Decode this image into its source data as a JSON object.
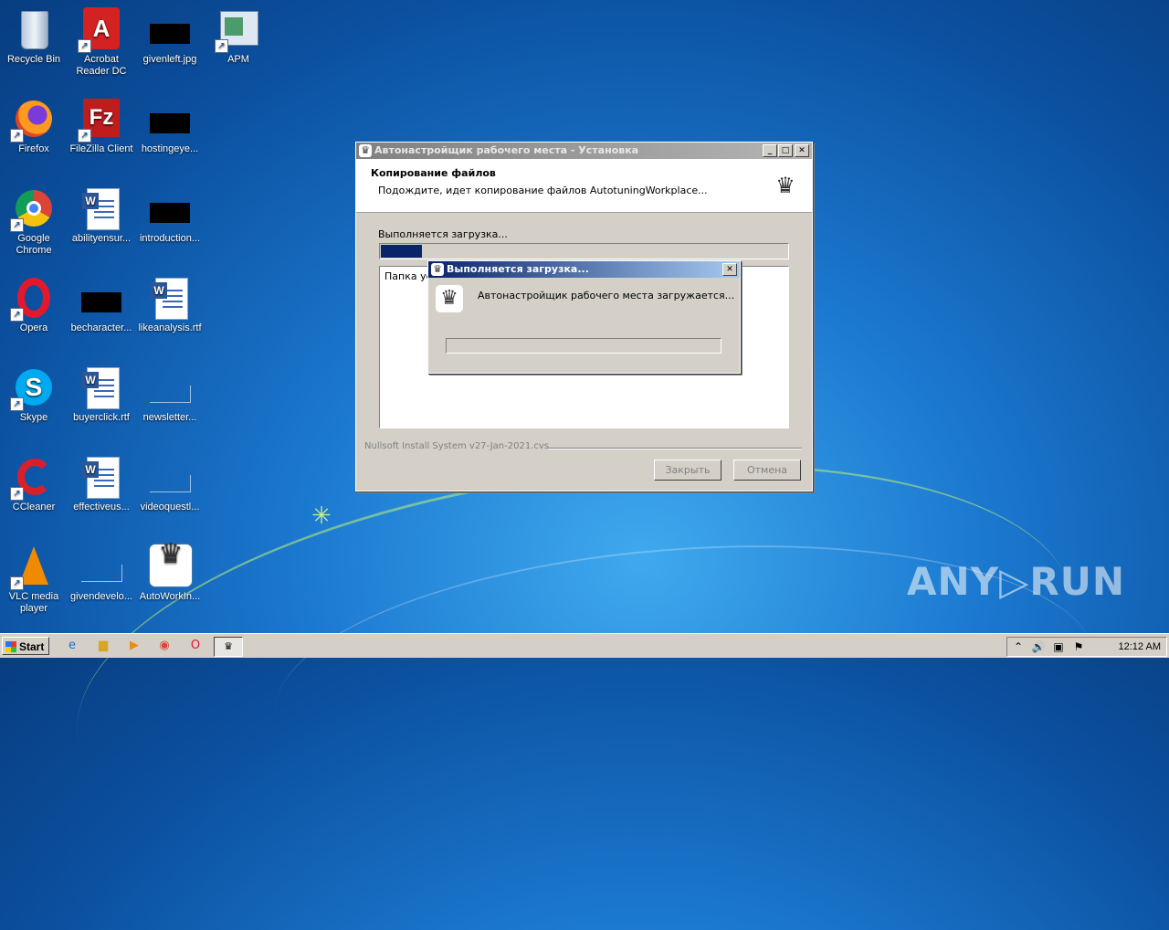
{
  "desktop": {
    "icons": [
      {
        "label": "Recycle Bin"
      },
      {
        "label": "Acrobat Reader DC"
      },
      {
        "label": "givenleft.jpg"
      },
      {
        "label": "APM"
      },
      {
        "label": "Firefox"
      },
      {
        "label": "FileZilla Client"
      },
      {
        "label": "hostingeye..."
      },
      {
        "label": "Google Chrome"
      },
      {
        "label": "abilityensur..."
      },
      {
        "label": "introduction..."
      },
      {
        "label": "Opera"
      },
      {
        "label": "becharacter..."
      },
      {
        "label": "likeanalysis.rtf"
      },
      {
        "label": "Skype"
      },
      {
        "label": "buyerclick.rtf"
      },
      {
        "label": "newsletter..."
      },
      {
        "label": "CCleaner"
      },
      {
        "label": "effectiveus..."
      },
      {
        "label": "videoquestl..."
      },
      {
        "label": "VLC media player"
      },
      {
        "label": "givendevelo..."
      },
      {
        "label": "AutoWorkIn..."
      }
    ],
    "watermark": "ANY▷RUN"
  },
  "installer": {
    "title": "Автонастройщик рабочего места - Установка",
    "header_title": "Копирование файлов",
    "header_subtitle": "Подождите, идет копирование файлов AutotuningWorkplace...",
    "status": "Выполняется загрузка...",
    "progress": 0.1,
    "log_text": "Папка ус",
    "branding": "Nullsoft Install System v27-Jan-2021.cvs",
    "close_label": "Закрыть",
    "cancel_label": "Отмена"
  },
  "popup": {
    "title": "Выполняется загрузка...",
    "message": "Автонастройщик рабочего места загружается...",
    "progress": 0
  },
  "taskbar": {
    "start_label": "Start",
    "clock": "12:12 AM"
  }
}
